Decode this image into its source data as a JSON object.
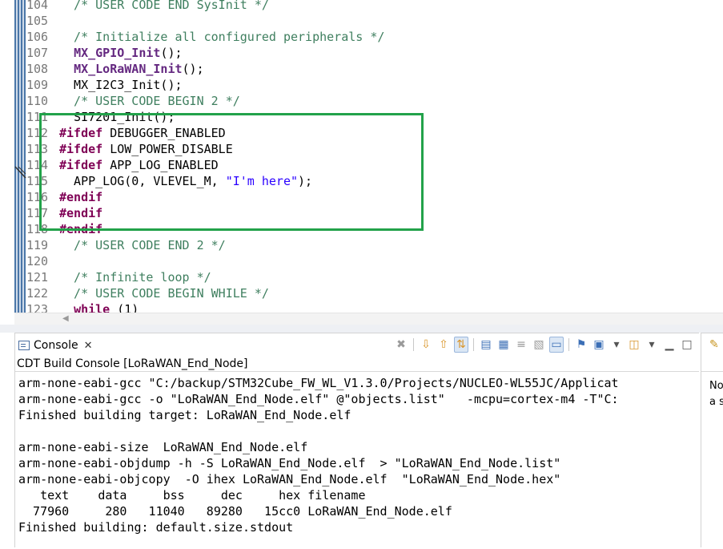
{
  "editor": {
    "lines": [
      {
        "n": "104",
        "segs": [
          {
            "t": "  /* USER CODE END SysInit */",
            "c": "cm"
          }
        ]
      },
      {
        "n": "105",
        "segs": []
      },
      {
        "n": "106",
        "segs": [
          {
            "t": "  /* Initialize all configured peripherals */",
            "c": "cm"
          }
        ]
      },
      {
        "n": "107",
        "segs": [
          {
            "t": "  ",
            "c": ""
          },
          {
            "t": "MX_GPIO_Init",
            "c": "fn"
          },
          {
            "t": "();",
            "c": ""
          }
        ]
      },
      {
        "n": "108",
        "segs": [
          {
            "t": "  ",
            "c": ""
          },
          {
            "t": "MX_LoRaWAN_Init",
            "c": "fn"
          },
          {
            "t": "();",
            "c": ""
          }
        ]
      },
      {
        "n": "109",
        "segs": [
          {
            "t": "  MX_I2C3_Init();",
            "c": ""
          }
        ]
      },
      {
        "n": "110",
        "segs": [
          {
            "t": "  /* USER CODE BEGIN 2 */",
            "c": "cm"
          }
        ]
      },
      {
        "n": "111",
        "segs": [
          {
            "t": "  SI7201_Init();",
            "c": ""
          }
        ]
      },
      {
        "n": "112",
        "segs": [
          {
            "t": "#ifdef",
            "c": "kw"
          },
          {
            "t": " DEBUGGER_ENABLED",
            "c": ""
          }
        ]
      },
      {
        "n": "113",
        "segs": [
          {
            "t": "#ifdef",
            "c": "kw"
          },
          {
            "t": " LOW_POWER_DISABLE",
            "c": ""
          }
        ]
      },
      {
        "n": "114",
        "segs": [
          {
            "t": "#ifdef",
            "c": "kw"
          },
          {
            "t": " APP_LOG_ENABLED",
            "c": ""
          }
        ]
      },
      {
        "n": "115",
        "segs": [
          {
            "t": "  APP_LOG(0, VLEVEL_M, ",
            "c": ""
          },
          {
            "t": "\"I'm here\"",
            "c": "str"
          },
          {
            "t": ");",
            "c": ""
          }
        ]
      },
      {
        "n": "116",
        "segs": [
          {
            "t": "#endif",
            "c": "kw"
          }
        ]
      },
      {
        "n": "117",
        "segs": [
          {
            "t": "#endif",
            "c": "kw"
          }
        ]
      },
      {
        "n": "118",
        "segs": [
          {
            "t": "#endif",
            "c": "kw"
          }
        ]
      },
      {
        "n": "119",
        "segs": [
          {
            "t": "  /* USER CODE END 2 */",
            "c": "cm"
          }
        ]
      },
      {
        "n": "120",
        "segs": []
      },
      {
        "n": "121",
        "segs": [
          {
            "t": "  /* Infinite loop */",
            "c": "cm"
          }
        ]
      },
      {
        "n": "122",
        "segs": [
          {
            "t": "  /* USER CODE BEGIN WHILE */",
            "c": "cm"
          }
        ]
      },
      {
        "n": "123",
        "segs": [
          {
            "t": "  ",
            "c": ""
          },
          {
            "t": "while",
            "c": "kw"
          },
          {
            "t": " (1)",
            "c": ""
          }
        ]
      }
    ]
  },
  "console": {
    "tab_label": "Console",
    "tab_close": "✕",
    "title": "CDT Build Console [LoRaWAN_End_Node]",
    "lines": [
      "arm-none-eabi-gcc \"C:/backup/STM32Cube_FW_WL_V1.3.0/Projects/NUCLEO-WL55JC/Applicat",
      "arm-none-eabi-gcc -o \"LoRaWAN_End_Node.elf\" @\"objects.list\"   -mcpu=cortex-m4 -T\"C:",
      "Finished building target: LoRaWAN_End_Node.elf",
      "",
      "arm-none-eabi-size  LoRaWAN_End_Node.elf",
      "arm-none-eabi-objdump -h -S LoRaWAN_End_Node.elf  > \"LoRaWAN_End_Node.list\"",
      "arm-none-eabi-objcopy  -O ihex LoRaWAN_End_Node.elf  \"LoRaWAN_End_Node.hex\"",
      "   text    data     bss     dec     hex filename",
      "  77960     280   11040   89280   15cc0 LoRaWAN_End_Node.elf",
      "Finished building: default.size.stdout"
    ]
  },
  "right_panel": {
    "line1": "No",
    "line2": "a s"
  },
  "toolbar_icons": [
    {
      "name": "clear-console-icon",
      "glyph": "✖",
      "style": "grey"
    },
    {
      "name": "sep"
    },
    {
      "name": "scroll-down-icon",
      "glyph": "⇩",
      "style": "orange"
    },
    {
      "name": "scroll-up-icon",
      "glyph": "⇧",
      "style": "orange"
    },
    {
      "name": "scroll-lock-icon",
      "glyph": "⇅",
      "style": "orange active"
    },
    {
      "name": "sep"
    },
    {
      "name": "copy-build-log-icon",
      "glyph": "▤",
      "style": "blue"
    },
    {
      "name": "save-log-icon",
      "glyph": "▦",
      "style": "blue"
    },
    {
      "name": "wrap-icon",
      "glyph": "≡",
      "style": "grey"
    },
    {
      "name": "pin-log-icon",
      "glyph": "▧",
      "style": "grey"
    },
    {
      "name": "word-wrap-icon",
      "glyph": "▭",
      "style": "blue active"
    },
    {
      "name": "sep"
    },
    {
      "name": "pin-console-icon",
      "glyph": "⚑",
      "style": "blue"
    },
    {
      "name": "display-console-icon",
      "glyph": "▣",
      "style": "blue"
    },
    {
      "name": "display-console-dropdown-icon",
      "glyph": "▾",
      "style": ""
    },
    {
      "name": "new-console-icon",
      "glyph": "◫",
      "style": "orange"
    },
    {
      "name": "new-console-dropdown-icon",
      "glyph": "▾",
      "style": ""
    },
    {
      "name": "minimize-icon",
      "glyph": "▁",
      "style": ""
    },
    {
      "name": "maximize-icon",
      "glyph": "□",
      "style": ""
    }
  ]
}
